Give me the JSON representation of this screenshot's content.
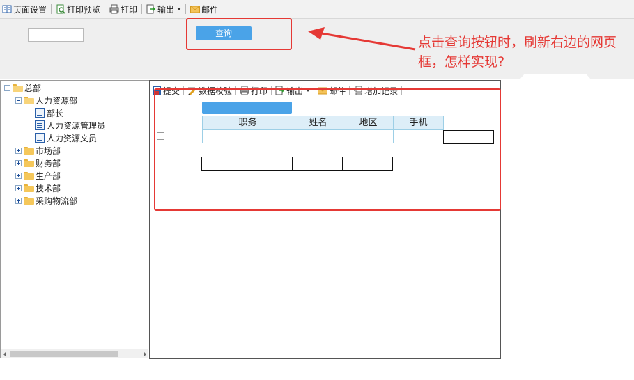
{
  "top_toolbar": {
    "items": [
      {
        "label": "页面设置",
        "icon": "page-setup-icon"
      },
      {
        "label": "打印预览",
        "icon": "print-preview-icon"
      },
      {
        "label": "打印",
        "icon": "printer-icon"
      },
      {
        "label": "输出",
        "icon": "export-icon"
      },
      {
        "label": "邮件",
        "icon": "mail-icon"
      }
    ]
  },
  "query": {
    "input_value": "",
    "button_label": "查询"
  },
  "annotation": {
    "text": "点击查询按钮时，刷新右边的网页框，怎样实现?",
    "color": "#e53935"
  },
  "tree": {
    "root": "总部",
    "hr_department": "人力资源部",
    "hr_children": [
      "部长",
      "人力资源管理员",
      "人力资源文员"
    ],
    "other_departments": [
      "市场部",
      "财务部",
      "生产部",
      "技术部",
      "采购物流部"
    ]
  },
  "right_frame": {
    "toolbar": {
      "submit": "提交",
      "validate": "数据校验",
      "print": "打印",
      "export": "输出",
      "mail": "邮件",
      "add_record": "增加记录"
    },
    "table": {
      "columns": [
        "职务",
        "姓名",
        "地区",
        "手机"
      ]
    }
  },
  "colors": {
    "accent_blue": "#4aa3e8",
    "annotation_red": "#e53935"
  }
}
